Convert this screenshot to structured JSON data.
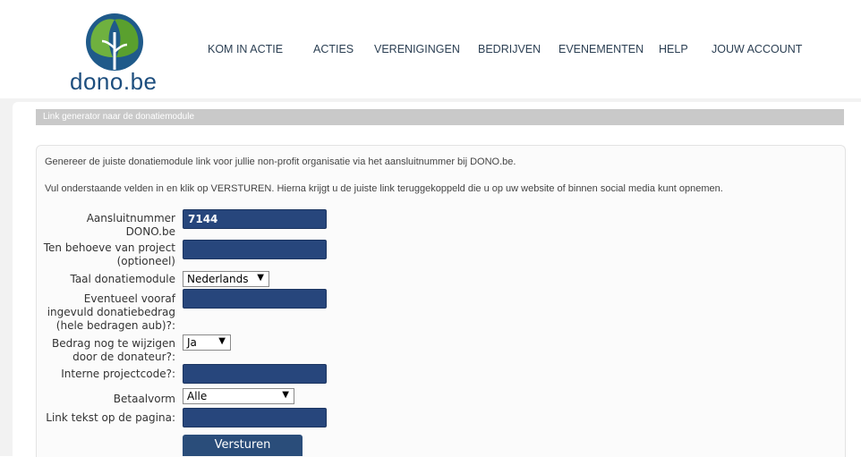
{
  "logo": {
    "text": "dono.be",
    "icon": "globe-leaf-logo"
  },
  "nav": {
    "items": [
      {
        "label": "KOM IN ACTIE"
      },
      {
        "label": "ACTIES"
      },
      {
        "label": "VERENIGINGEN"
      },
      {
        "label": "BEDRIJVEN"
      },
      {
        "label": "EVENEMENTEN"
      },
      {
        "label": "HELP"
      },
      {
        "label": "JOUW ACCOUNT"
      }
    ]
  },
  "section": {
    "title": "Link generator naar de donatiemodule"
  },
  "intro": {
    "line1": "Genereer de juiste donatiemodule link voor jullie non-profit organisatie via het aansluitnummer bij DONO.be.",
    "line2": "Vul onderstaande velden in en klik op VERSTUREN. Hierna krijgt u de juiste link teruggekoppeld die u op uw website of binnen social media kunt opnemen."
  },
  "form": {
    "aansluit": {
      "label": "Aansluitnummer DONO.be",
      "value": "7144"
    },
    "project": {
      "label": "Ten behoeve van project (optioneel)",
      "value": ""
    },
    "taal": {
      "label": "Taal donatiemodule",
      "value": "Nederlands"
    },
    "bedrag": {
      "label": "Eventueel vooraf ingevuld donatiebedrag (hele bedragen aub)?:",
      "value": ""
    },
    "wijzigen": {
      "label": "Bedrag nog te wijzigen door de donateur?:",
      "value": "Ja"
    },
    "projectcode": {
      "label": "Interne projectcode?:",
      "value": ""
    },
    "betaalvorm": {
      "label": "Betaalvorm",
      "value": "Alle"
    },
    "linktekst": {
      "label": "Link tekst op de pagina:",
      "value": ""
    },
    "submit_label": "Versturen"
  },
  "colors": {
    "field_bg": "#27467c",
    "brand": "#1d4e7e",
    "accent_green": "#6fb13f"
  }
}
